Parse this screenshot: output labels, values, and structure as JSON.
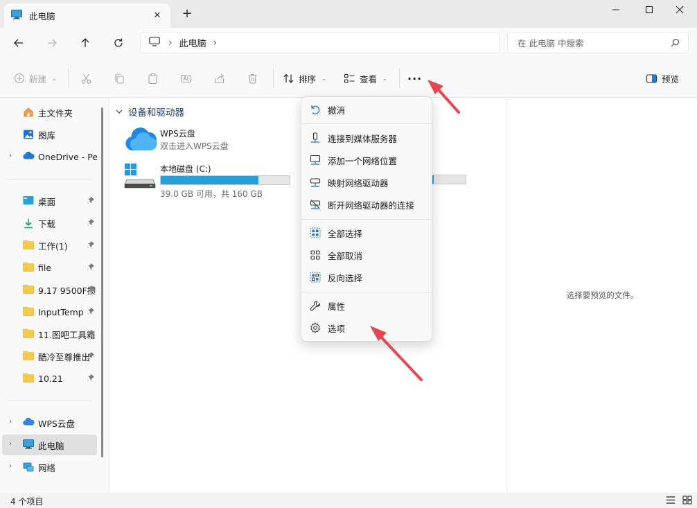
{
  "window": {
    "tab_title": "此电脑",
    "new_tab_symbol": "+",
    "close_tab_symbol": "✕"
  },
  "address": {
    "crumbs": [
      "此电脑"
    ],
    "separator": "›"
  },
  "search": {
    "placeholder": "在 此电脑 中搜索"
  },
  "toolbar": {
    "new_label": "新建",
    "sort_label": "排序",
    "view_label": "查看",
    "more_label": "···",
    "preview_label": "预览"
  },
  "sidebar": {
    "items": [
      {
        "label": "主文件夹",
        "icon": "home-icon"
      },
      {
        "label": "图库",
        "icon": "gallery-icon"
      },
      {
        "label": "OneDrive - Per",
        "icon": "onedrive-icon",
        "expandable": true
      },
      {
        "label": "桌面",
        "icon": "desktop-icon",
        "pinned": true
      },
      {
        "label": "下载",
        "icon": "download-icon",
        "pinned": true
      },
      {
        "label": "工作(1)",
        "icon": "folder-icon",
        "pinned": true
      },
      {
        "label": "file",
        "icon": "folder-icon",
        "pinned": true
      },
      {
        "label": "9.17 9500F攒",
        "icon": "folder-icon",
        "pinned": true
      },
      {
        "label": "InputTemp",
        "icon": "folder-icon",
        "pinned": true
      },
      {
        "label": "11.图吧工具箱",
        "icon": "folder-icon",
        "pinned": true
      },
      {
        "label": "酷冷至尊推出",
        "icon": "folder-icon",
        "pinned": true
      },
      {
        "label": "10.21",
        "icon": "folder-icon",
        "pinned": true
      },
      {
        "label": "WPS云盘",
        "icon": "wps-cloud-icon",
        "expandable": true
      },
      {
        "label": "此电脑",
        "icon": "this-pc-icon",
        "expandable": true,
        "selected": true
      },
      {
        "label": "网络",
        "icon": "network-icon",
        "expandable": true
      }
    ]
  },
  "main": {
    "section_title": "设备和驱动器",
    "drives": [
      {
        "name": "WPS云盘",
        "subtitle": "双击进入WPS云盘"
      },
      {
        "name": "本地磁盘 (C:)",
        "subtitle": "39.0 GB 可用，共 160 GB",
        "used_fraction": 0.756
      }
    ],
    "preview_text": "选择要预览的文件。"
  },
  "context_menu": {
    "items": [
      {
        "label": "撤消",
        "icon": "undo-icon"
      },
      {
        "label": "连接到媒体服务器",
        "icon": "media-server-icon"
      },
      {
        "label": "添加一个网络位置",
        "icon": "network-location-icon"
      },
      {
        "label": "映射网络驱动器",
        "icon": "map-drive-icon"
      },
      {
        "label": "断开网络驱动器的连接",
        "icon": "disconnect-drive-icon"
      },
      {
        "label": "全部选择",
        "icon": "select-all-icon"
      },
      {
        "label": "全部取消",
        "icon": "select-none-icon"
      },
      {
        "label": "反向选择",
        "icon": "invert-selection-icon"
      },
      {
        "label": "属性",
        "icon": "properties-icon"
      },
      {
        "label": "选项",
        "icon": "options-icon"
      }
    ]
  },
  "status": {
    "item_count": "4 个项目"
  },
  "colors": {
    "accent": "#0067c0",
    "drive_fill": "#26a0da",
    "folder": "#f7c948",
    "annotation_arrow": "#e8464f"
  }
}
